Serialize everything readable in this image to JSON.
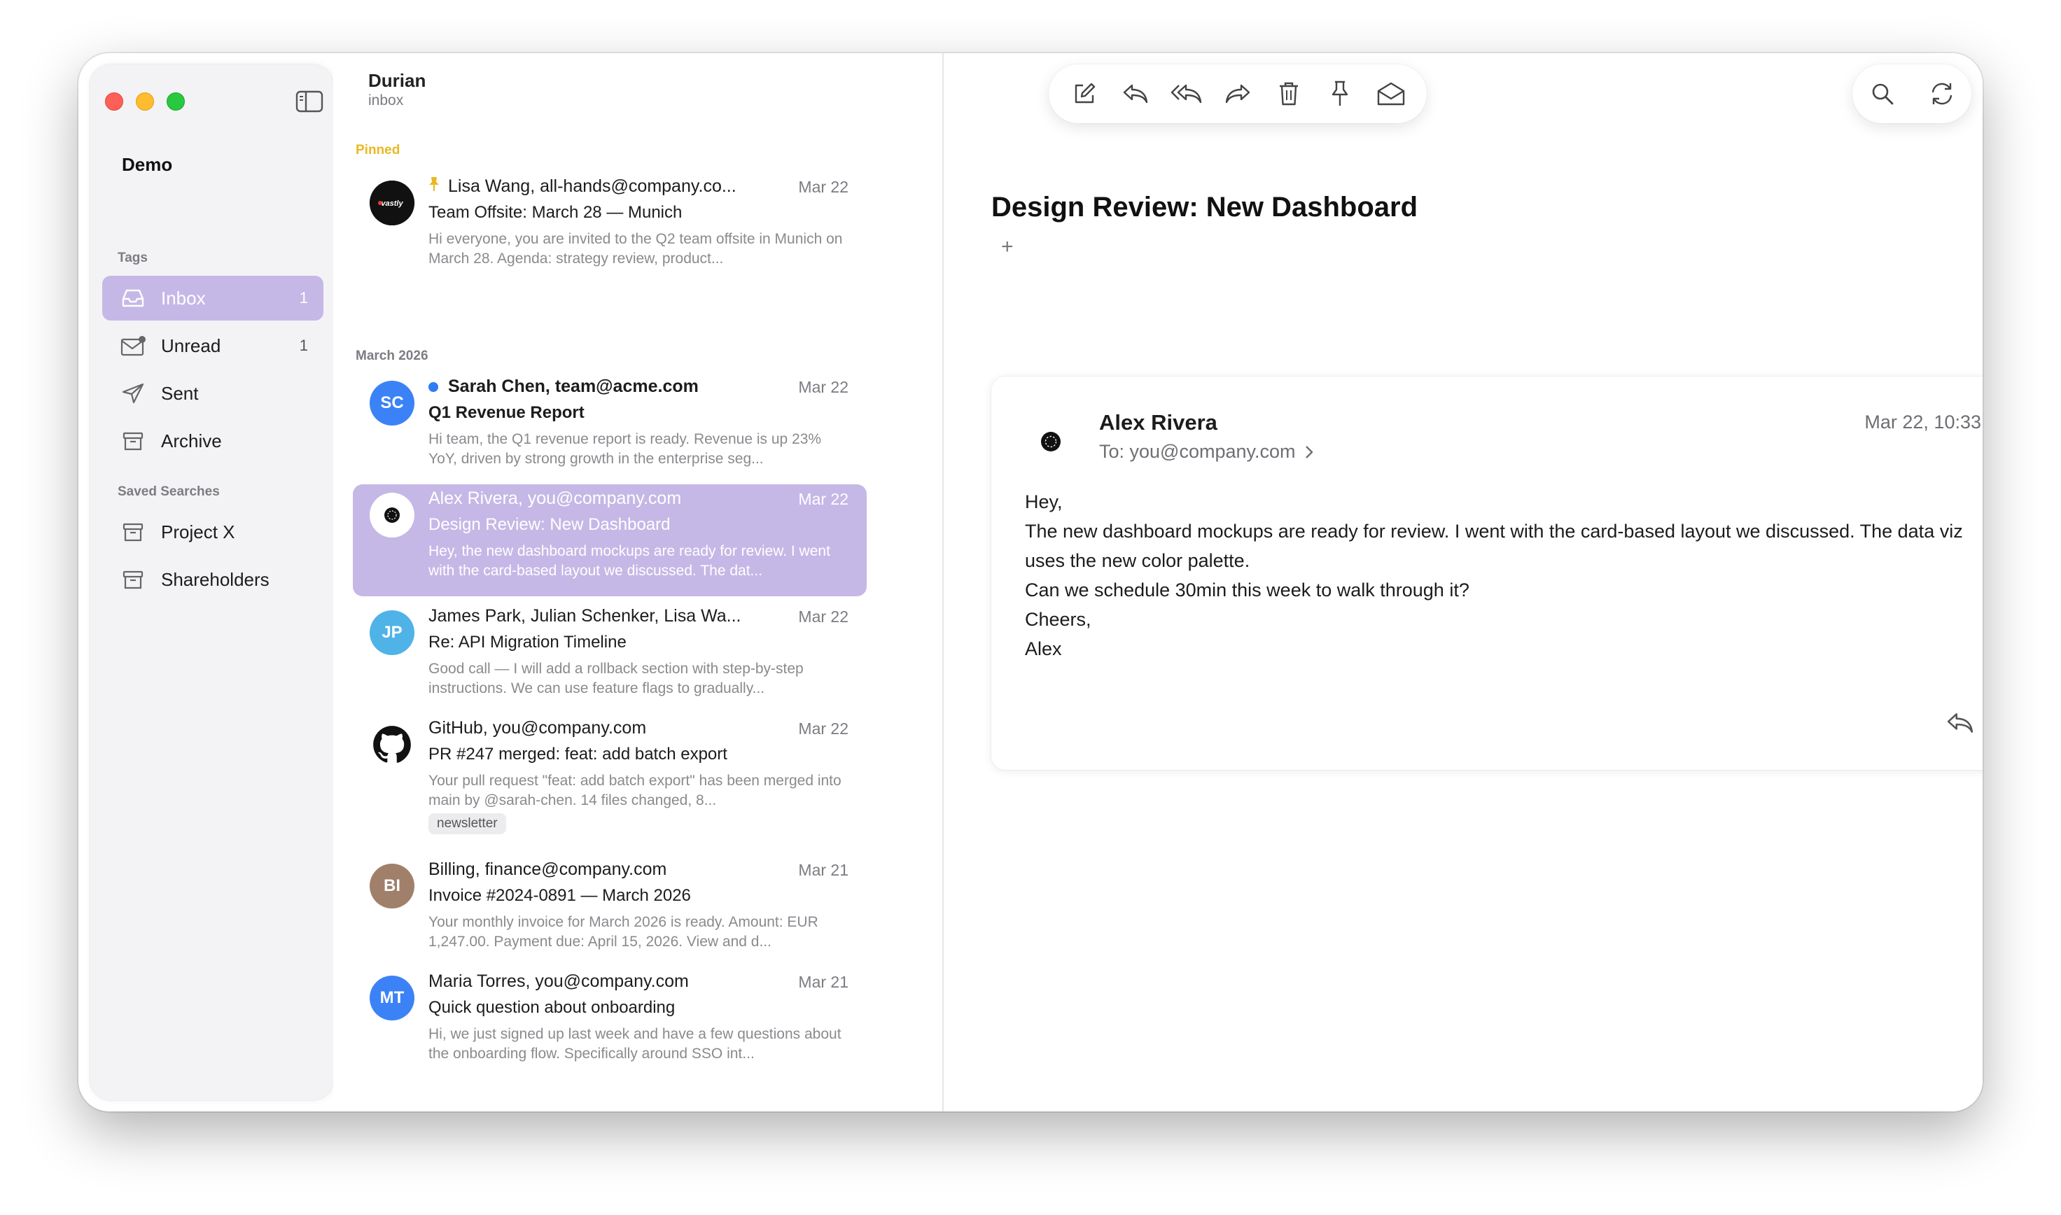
{
  "sidebar": {
    "account": "Demo",
    "tags_header": "Tags",
    "tags": [
      {
        "label": "Inbox",
        "count": "1",
        "icon": "inbox-icon"
      },
      {
        "label": "Unread",
        "count": "1",
        "icon": "unread-mail-icon"
      },
      {
        "label": "Sent",
        "count": "",
        "icon": "paper-plane-icon"
      },
      {
        "label": "Archive",
        "count": "",
        "icon": "archive-box-icon"
      }
    ],
    "saved_header": "Saved Searches",
    "saved": [
      {
        "label": "Project X",
        "icon": "archive-box-icon"
      },
      {
        "label": "Shareholders",
        "icon": "archive-box-icon"
      }
    ]
  },
  "list": {
    "title": "Durian",
    "subtitle": "inbox",
    "pinned_header": "Pinned",
    "month_header": "March 2026",
    "messages": [
      {
        "from": "Lisa Wang, all-hands@company.co...",
        "date": "Mar 22",
        "subject": "Team Offsite: March 28 — Munich",
        "preview": "Hi everyone, you are invited to the Q2 team offsite in Munich on March 28. Agenda: strategy review, product...",
        "avatar": "vastly",
        "pinned": true
      },
      {
        "from": "Sarah Chen, team@acme.com",
        "date": "Mar 22",
        "subject": "Q1 Revenue Report",
        "preview": "Hi team, the Q1 revenue report is ready. Revenue is up 23% YoY, driven by strong growth in the enterprise seg...",
        "avatar": "SC",
        "unread": true
      },
      {
        "from": "Alex Rivera, you@company.com",
        "date": "Mar 22",
        "subject": "Design Review: New Dashboard",
        "preview": "Hey, the new dashboard mockups are ready for review. I went with the card-based layout we discussed. The dat...",
        "avatar": "",
        "selected": true
      },
      {
        "from": "James Park, Julian Schenker, Lisa Wa...",
        "date": "Mar 22",
        "subject": "Re: API Migration Timeline",
        "preview": "Good call — I will add a rollback section with step-by-step instructions. We can use feature flags to gradually...",
        "avatar": "JP"
      },
      {
        "from": "GitHub, you@company.com",
        "date": "Mar 22",
        "subject": "PR #247 merged: feat: add batch export",
        "preview": "Your pull request \"feat: add batch export\" has been merged into main by @sarah-chen. 14 files changed, 8...",
        "avatar": "",
        "tag": "newsletter"
      },
      {
        "from": "Billing, finance@company.com",
        "date": "Mar 21",
        "subject": "Invoice #2024-0891 — March 2026",
        "preview": "Your monthly invoice for March 2026 is ready. Amount: EUR 1,247.00. Payment due: April 15, 2026. View and d...",
        "avatar": "BI"
      },
      {
        "from": "Maria Torres, you@company.com",
        "date": "Mar 21",
        "subject": "Quick question about onboarding",
        "preview": "Hi, we just signed up last week and have a few questions about the onboarding flow. Specifically around SSO int...",
        "avatar": "MT"
      }
    ]
  },
  "toolbar": {
    "icons": [
      "compose-icon",
      "reply-icon",
      "reply-all-icon",
      "forward-icon",
      "trash-icon",
      "pin-icon",
      "mark-unread-icon"
    ],
    "right_icons": [
      "search-icon",
      "refresh-icon"
    ]
  },
  "reader": {
    "subject": "Design Review: New Dashboard",
    "add_tag": "+",
    "sender": "Alex Rivera",
    "to": "To: you@company.com",
    "date": "Mar 22, 10:33",
    "body_lines": [
      "Hey,",
      "The new dashboard mockups are ready for review. I went with the card-based layout we discussed. The data viz uses the new color palette.",
      "Can we schedule 30min this week to walk through it?",
      "Cheers,",
      "Alex"
    ]
  },
  "colors": {
    "accent": "#c5b8e6",
    "pinned_header": "#e8b923",
    "unread_dot": "#2f7cf6",
    "avatar_sc": "#3b82f6",
    "avatar_jp": "#4fb3e8",
    "avatar_bi": "#a0806a",
    "avatar_mt": "#3b82f6"
  }
}
